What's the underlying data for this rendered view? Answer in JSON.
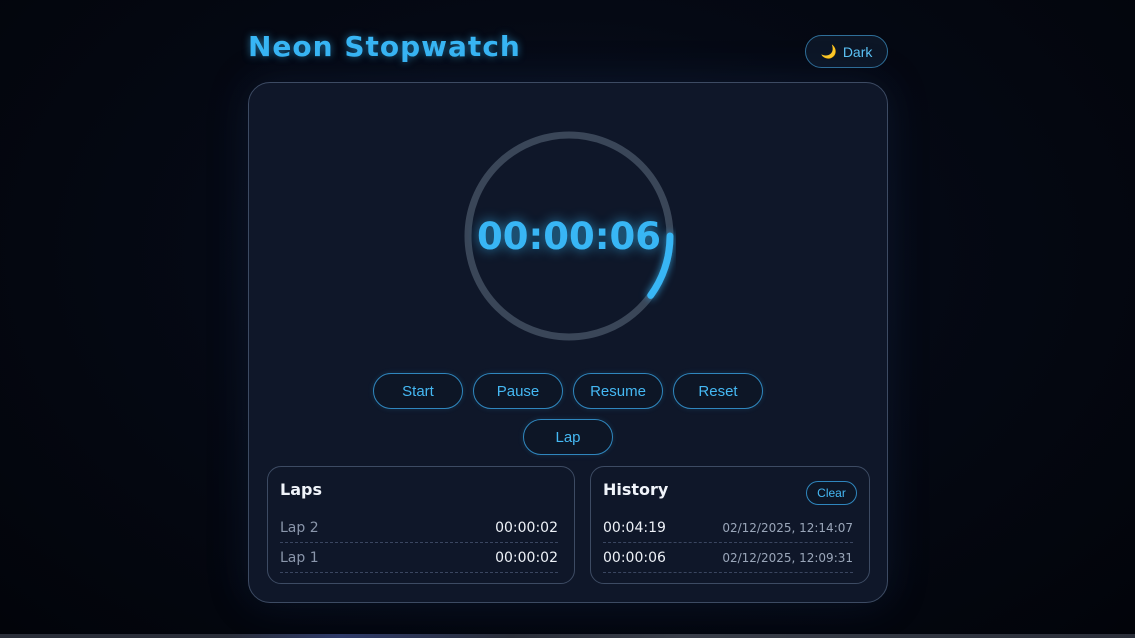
{
  "header": {
    "title": "Neon Stopwatch",
    "theme_toggle": {
      "icon": "moon-icon",
      "label": "Dark"
    }
  },
  "stopwatch": {
    "time": "00:00:06",
    "progress_fraction": 0.1,
    "accent_color": "#38b6f5",
    "track_color": "#3a4658"
  },
  "controls": {
    "start": "Start",
    "pause": "Pause",
    "resume": "Resume",
    "reset": "Reset",
    "lap": "Lap"
  },
  "laps": {
    "title": "Laps",
    "items": [
      {
        "label": "Lap 2",
        "time": "00:00:02"
      },
      {
        "label": "Lap 1",
        "time": "00:00:02"
      }
    ]
  },
  "history": {
    "title": "History",
    "clear_label": "Clear",
    "items": [
      {
        "duration": "00:04:19",
        "timestamp": "02/12/2025, 12:14:07"
      },
      {
        "duration": "00:00:06",
        "timestamp": "02/12/2025, 12:09:31"
      }
    ]
  }
}
